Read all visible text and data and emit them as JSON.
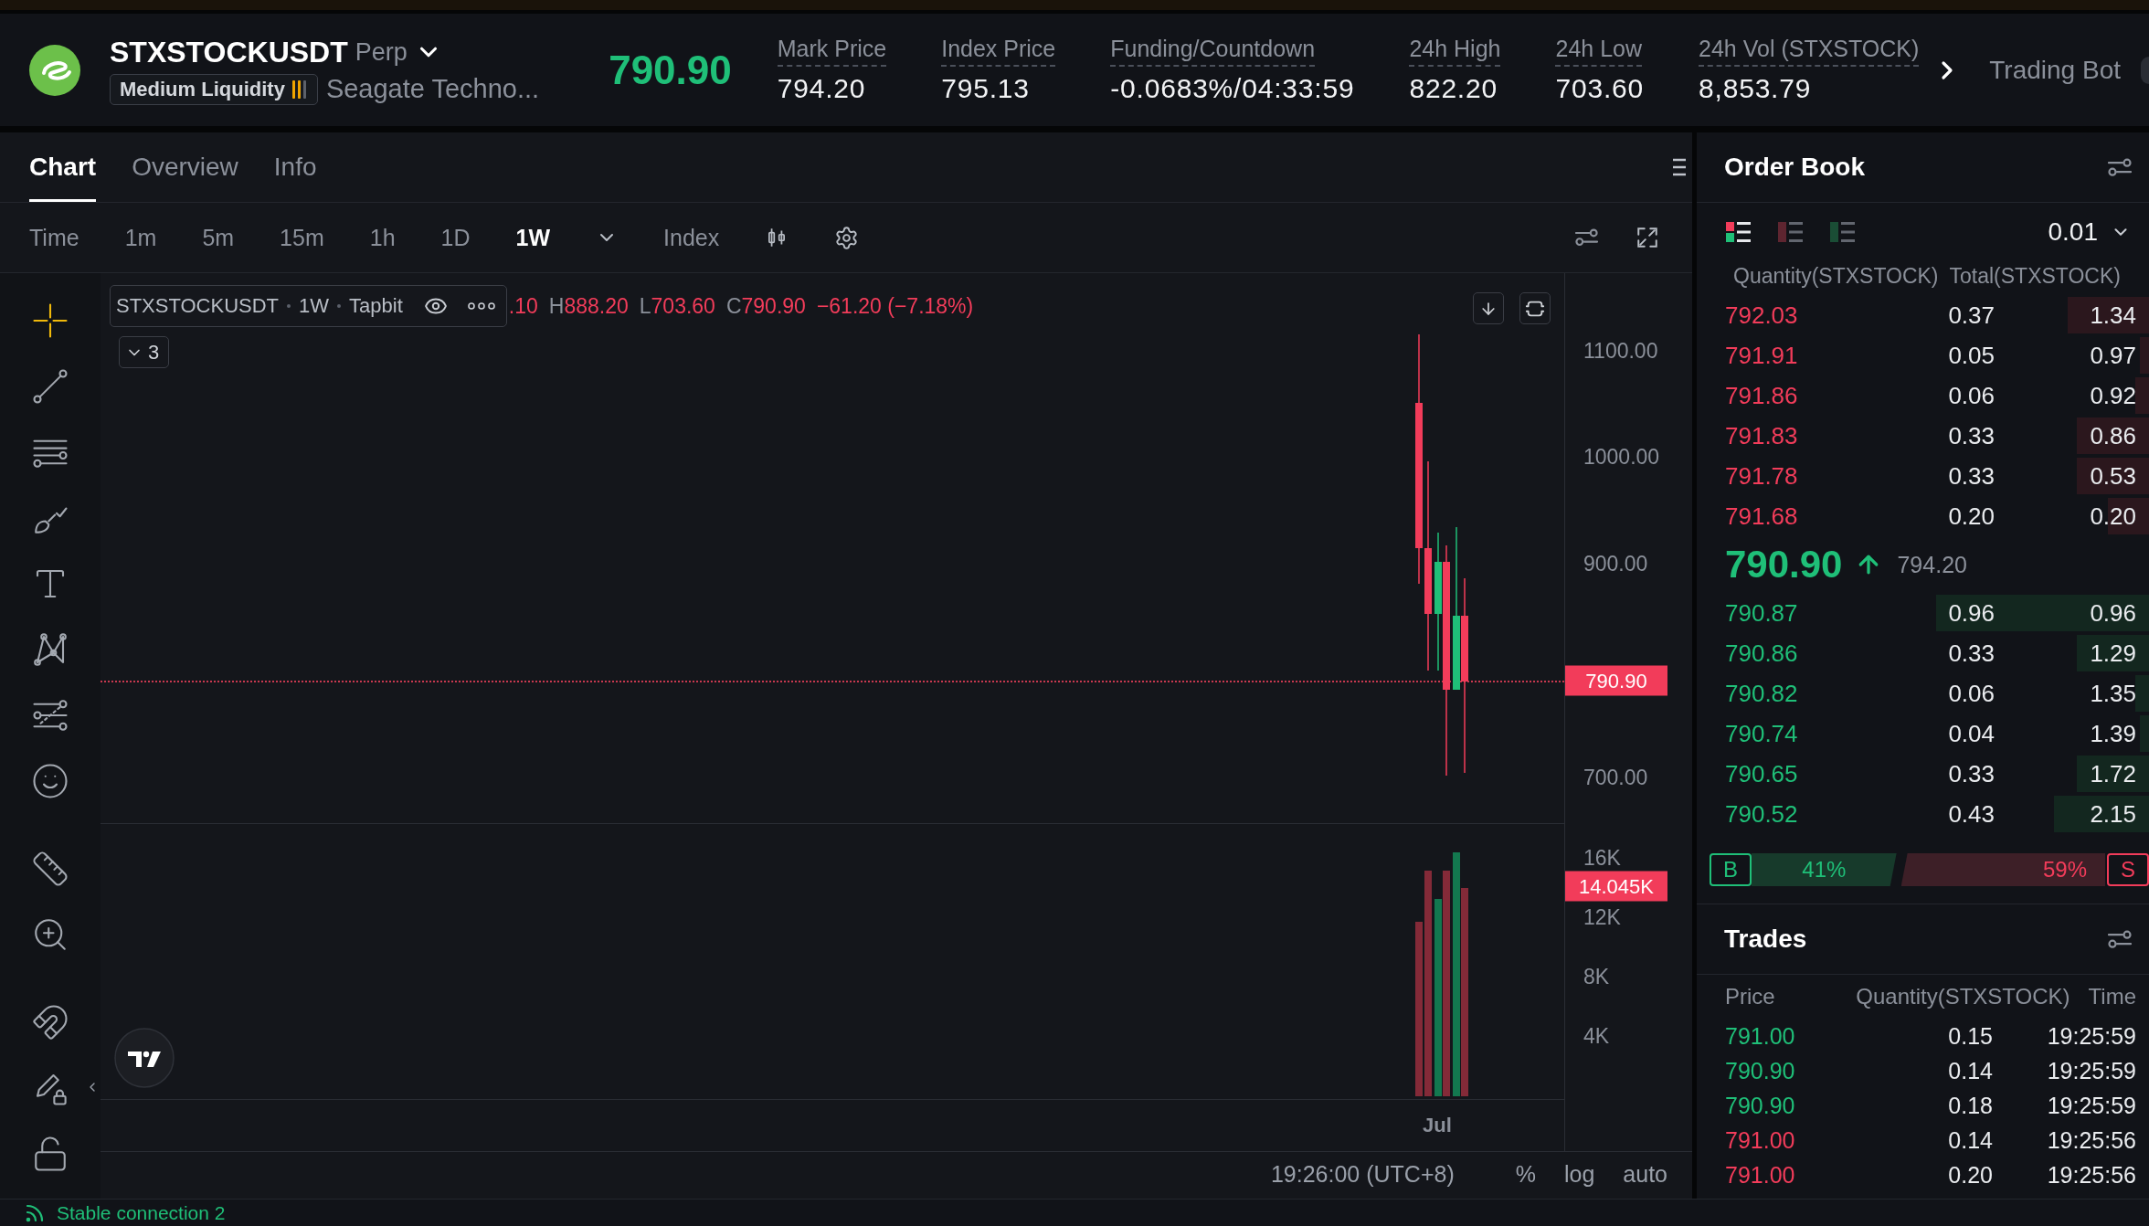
{
  "header": {
    "symbol": "STXSTOCKUSDT",
    "contract_type": "Perp",
    "liquidity": {
      "label": "Medium Liquidity",
      "level": 0.67
    },
    "company_name": "Seagate Techno...",
    "last_price": "790.90",
    "stats": [
      {
        "label": "Mark Price",
        "value": "794.20"
      },
      {
        "label": "Index Price",
        "value": "795.13"
      },
      {
        "label": "Funding/Countdown",
        "value": "-0.0683%/04:33:59"
      },
      {
        "label": "24h High",
        "value": "822.20"
      },
      {
        "label": "24h Low",
        "value": "703.60"
      },
      {
        "label": "24h Vol (STXSTOCK)",
        "value": "8,853.79"
      }
    ],
    "trading_bot": "Trading Bot"
  },
  "chart_panel": {
    "tabs": [
      {
        "label": "Chart",
        "selected": true
      },
      {
        "label": "Overview",
        "selected": false
      },
      {
        "label": "Info",
        "selected": false
      }
    ],
    "intervals": [
      {
        "label": "Time",
        "selected": false
      },
      {
        "label": "1m",
        "selected": false
      },
      {
        "label": "5m",
        "selected": false
      },
      {
        "label": "15m",
        "selected": false
      },
      {
        "label": "1h",
        "selected": false
      },
      {
        "label": "1D",
        "selected": false
      },
      {
        "label": "1W",
        "selected": true
      }
    ],
    "price_source": "Index",
    "drawing_tools": [
      {
        "tools": [
          {
            "kind": "crosshair",
            "selected": true
          },
          {
            "kind": "trend-line",
            "selected": false
          },
          {
            "kind": "parallel-lines",
            "selected": false
          },
          {
            "kind": "brush",
            "selected": false
          },
          {
            "kind": "text",
            "selected": false
          },
          {
            "kind": "pattern",
            "selected": false
          },
          {
            "kind": "levels",
            "selected": false
          },
          {
            "kind": "emoji",
            "selected": false
          }
        ]
      },
      {
        "tools": [
          {
            "kind": "ruler",
            "selected": false
          },
          {
            "kind": "zoom-in",
            "selected": false
          }
        ]
      },
      {
        "tools": [
          {
            "kind": "magnet",
            "selected": false
          },
          {
            "kind": "pencil-lock",
            "selected": false
          },
          {
            "kind": "unlock",
            "selected": false
          }
        ]
      }
    ],
    "legend": {
      "symbol": "STXSTOCKUSDT",
      "interval": "1W",
      "source": "Tapbit",
      "open_fragment": ".10",
      "values": [
        {
          "label": "H",
          "value": "888.20"
        },
        {
          "label": "L",
          "value": "703.60"
        },
        {
          "label": "C",
          "value": "790.90"
        }
      ],
      "change": "−61.20 (−7.18%)"
    },
    "indicator_count": "3",
    "price_axis": {
      "ticks": [
        "1100.00",
        "1000.00",
        "900.00",
        "700.00"
      ],
      "current_price": "790.90"
    },
    "volume_axis": {
      "ticks": [
        "16K",
        "12K",
        "8K",
        "4K"
      ],
      "current_volume": "14.045K"
    },
    "time_axis": [
      "Jul"
    ],
    "clock": "19:26:00 (UTC+8)",
    "scale_options": [
      "%",
      "log",
      "auto"
    ]
  },
  "order_book": {
    "title": "Order Book",
    "views": [
      {
        "kind": "both",
        "selected": true
      },
      {
        "kind": "asks",
        "selected": false
      },
      {
        "kind": "bids",
        "selected": false
      }
    ],
    "precision": "0.01",
    "columns": [
      "Quantity(STXSTOCK)",
      "Total(STXSTOCK)"
    ],
    "asks": [
      {
        "price": "792.03",
        "quantity": "0.37",
        "total": "1.34",
        "level": 0.18
      },
      {
        "price": "791.91",
        "quantity": "0.05",
        "total": "0.97",
        "level": 0.02
      },
      {
        "price": "791.86",
        "quantity": "0.06",
        "total": "0.92",
        "level": 0.03
      },
      {
        "price": "791.83",
        "quantity": "0.33",
        "total": "0.86",
        "level": 0.16
      },
      {
        "price": "791.78",
        "quantity": "0.33",
        "total": "0.53",
        "level": 0.16
      },
      {
        "price": "791.68",
        "quantity": "0.20",
        "total": "0.20",
        "level": 0.09
      }
    ],
    "last_price": "790.90",
    "price_up": true,
    "mark_price": "794.20",
    "bids": [
      {
        "price": "790.87",
        "quantity": "0.96",
        "total": "0.96",
        "level": 0.47
      },
      {
        "price": "790.86",
        "quantity": "0.33",
        "total": "1.29",
        "level": 0.16
      },
      {
        "price": "790.82",
        "quantity": "0.06",
        "total": "1.35",
        "level": 0.03
      },
      {
        "price": "790.74",
        "quantity": "0.04",
        "total": "1.39",
        "level": 0.02
      },
      {
        "price": "790.65",
        "quantity": "0.33",
        "total": "1.72",
        "level": 0.16
      },
      {
        "price": "790.52",
        "quantity": "0.43",
        "total": "2.15",
        "level": 0.21
      }
    ],
    "ratio": {
      "buy_label": "B",
      "buy": "41%",
      "sell": "59%",
      "sell_label": "S",
      "level": 0.41
    }
  },
  "trades": {
    "title": "Trades",
    "columns": [
      "Price",
      "Quantity(STXSTOCK)",
      "Time"
    ],
    "rows": [
      {
        "kind": "buy",
        "price": "791.00",
        "quantity": "0.15",
        "time": "19:25:59"
      },
      {
        "kind": "buy",
        "price": "790.90",
        "quantity": "0.14",
        "time": "19:25:59"
      },
      {
        "kind": "buy",
        "price": "790.90",
        "quantity": "0.18",
        "time": "19:25:59"
      },
      {
        "kind": "sell",
        "price": "791.00",
        "quantity": "0.14",
        "time": "19:25:56"
      },
      {
        "kind": "sell",
        "price": "791.00",
        "quantity": "0.20",
        "time": "19:25:56"
      }
    ]
  },
  "status_bar": {
    "connection": "Stable connection 2"
  }
}
